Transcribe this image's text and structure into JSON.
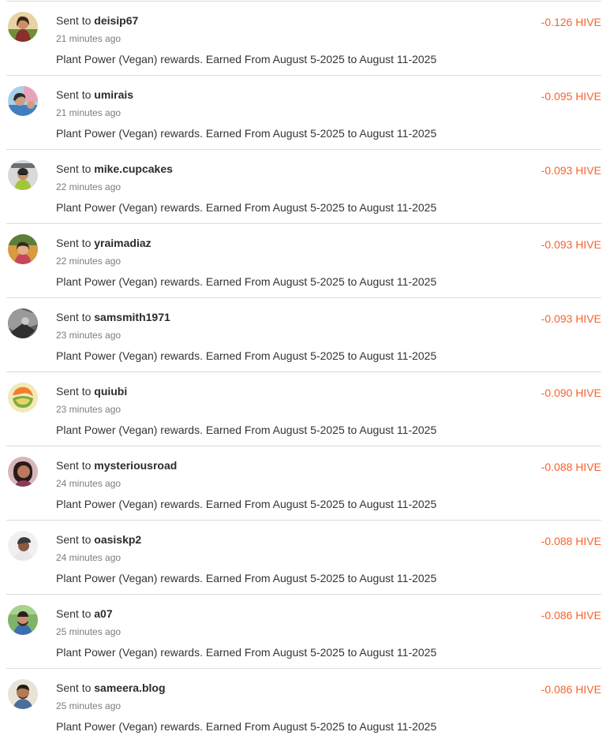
{
  "accent_color": "#f4642f",
  "transfers": [
    {
      "prefix": "Sent to",
      "user": "deisip67",
      "time": "21 minutes ago",
      "memo": "Plant Power (Vegan) rewards. Earned From August 5-2025 to August 11-2025",
      "amount": "-0.126 HIVE",
      "avatar_icon": "user-avatar-icon"
    },
    {
      "prefix": "Sent to",
      "user": "umirais",
      "time": "21 minutes ago",
      "memo": "Plant Power (Vegan) rewards. Earned From August 5-2025 to August 11-2025",
      "amount": "-0.095 HIVE",
      "avatar_icon": "user-avatar-icon"
    },
    {
      "prefix": "Sent to",
      "user": "mike.cupcakes",
      "time": "22 minutes ago",
      "memo": "Plant Power (Vegan) rewards. Earned From August 5-2025 to August 11-2025",
      "amount": "-0.093 HIVE",
      "avatar_icon": "user-avatar-icon"
    },
    {
      "prefix": "Sent to",
      "user": "yraimadiaz",
      "time": "22 minutes ago",
      "memo": "Plant Power (Vegan) rewards. Earned From August 5-2025 to August 11-2025",
      "amount": "-0.093 HIVE",
      "avatar_icon": "user-avatar-icon"
    },
    {
      "prefix": "Sent to",
      "user": "samsmith1971",
      "time": "23 minutes ago",
      "memo": "Plant Power (Vegan) rewards. Earned From August 5-2025 to August 11-2025",
      "amount": "-0.093 HIVE",
      "avatar_icon": "user-avatar-icon"
    },
    {
      "prefix": "Sent to",
      "user": "quiubi",
      "time": "23 minutes ago",
      "memo": "Plant Power (Vegan) rewards. Earned From August 5-2025 to August 11-2025",
      "amount": "-0.090 HIVE",
      "avatar_icon": "user-avatar-icon"
    },
    {
      "prefix": "Sent to",
      "user": "mysteriousroad",
      "time": "24 minutes ago",
      "memo": "Plant Power (Vegan) rewards. Earned From August 5-2025 to August 11-2025",
      "amount": "-0.088 HIVE",
      "avatar_icon": "user-avatar-icon"
    },
    {
      "prefix": "Sent to",
      "user": "oasiskp2",
      "time": "24 minutes ago",
      "memo": "Plant Power (Vegan) rewards. Earned From August 5-2025 to August 11-2025",
      "amount": "-0.088 HIVE",
      "avatar_icon": "user-avatar-icon"
    },
    {
      "prefix": "Sent to",
      "user": "a07",
      "time": "25 minutes ago",
      "memo": "Plant Power (Vegan) rewards. Earned From August 5-2025 to August 11-2025",
      "amount": "-0.086 HIVE",
      "avatar_icon": "user-avatar-icon"
    },
    {
      "prefix": "Sent to",
      "user": "sameera.blog",
      "time": "25 minutes ago",
      "memo": "Plant Power (Vegan) rewards. Earned From August 5-2025 to August 11-2025",
      "amount": "-0.086 HIVE",
      "avatar_icon": "user-avatar-icon"
    }
  ]
}
